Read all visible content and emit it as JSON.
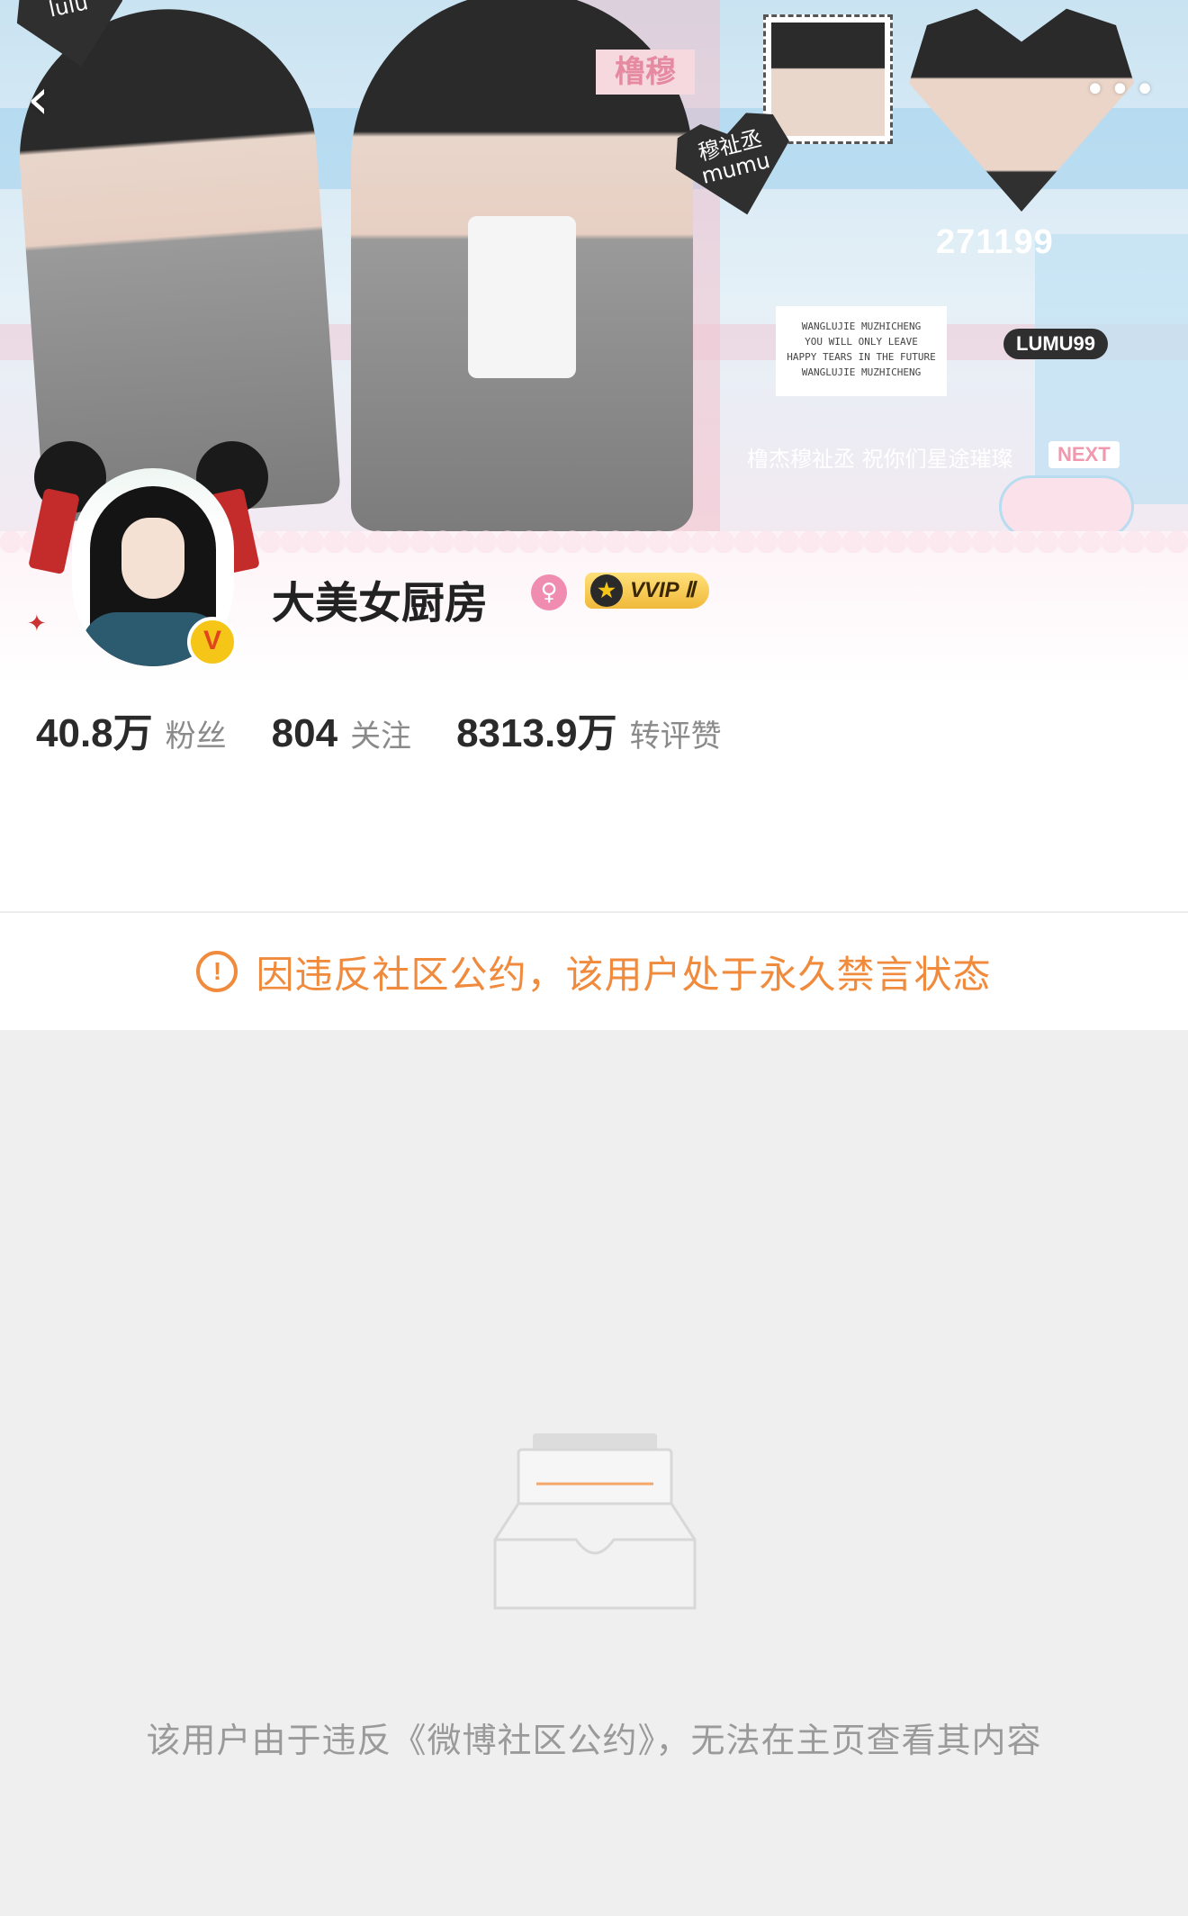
{
  "banner": {
    "tag_left": "lulu",
    "tag_right": "穆祉丞 mumu",
    "name_plate": "橹穆",
    "number": "271199",
    "note_lines": [
      "WANGLUJIE MUZHICHENG",
      "YOU WILL ONLY LEAVE",
      "HAPPY TEARS IN THE FUTURE",
      "WANGLUJIE MUZHICHENG"
    ],
    "badge": "LUMU99",
    "blessing": "橹杰穆祉丞 祝你们星途璀璨",
    "next_label": "NEXT"
  },
  "nav": {
    "back_icon": "‹",
    "more_icon": "•••"
  },
  "profile": {
    "username": "大美女厨房",
    "gender_icon": "♀",
    "vip_label": "VVIP Ⅱ",
    "vip_crown": "★",
    "verified_badge": "V",
    "stats": [
      {
        "value": "40.8万",
        "label": "粉丝"
      },
      {
        "value": "804",
        "label": "关注"
      },
      {
        "value": "8313.9万",
        "label": "转评赞"
      }
    ]
  },
  "warning": {
    "icon": "!",
    "text": "因违反社区公约，该用户处于永久禁言状态"
  },
  "empty_state": {
    "text": "该用户由于违反《微博社区公约》，无法在主页查看其内容"
  },
  "colors": {
    "accent_orange": "#f08a3c",
    "text_gray": "#9a9a9a",
    "background": "#efefef"
  }
}
